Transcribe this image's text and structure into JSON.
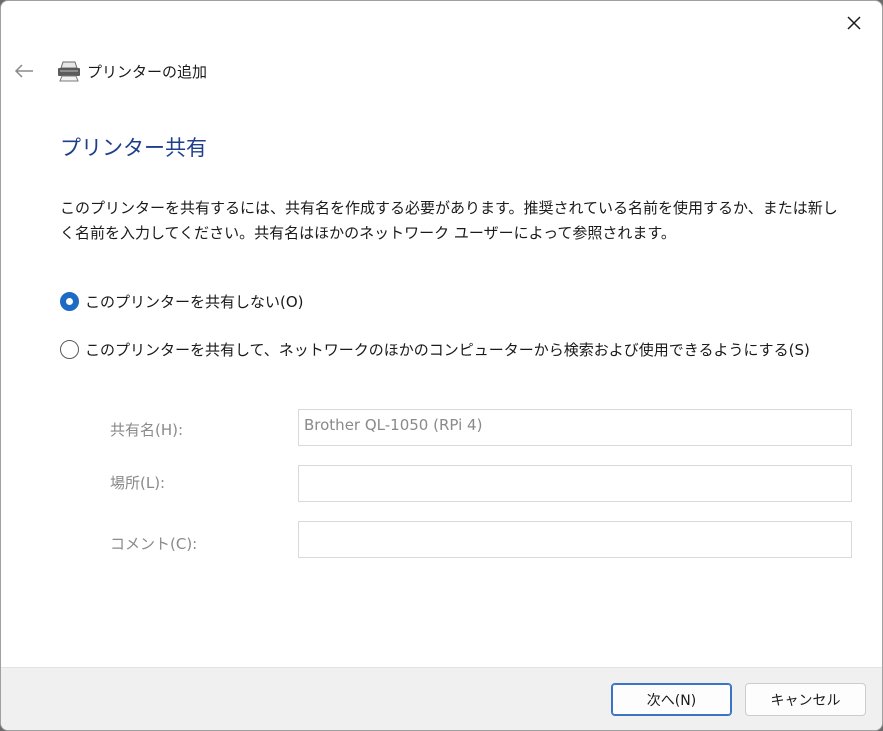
{
  "window": {
    "header_title": "プリンターの追加",
    "page_title": "プリンター共有",
    "description": "このプリンターを共有するには、共有名を作成する必要があります。推奨されている名前を使用するか、または新しく名前を入力してください。共有名はほかのネットワーク ユーザーによって参照されます。"
  },
  "sharing": {
    "options": [
      {
        "label": "このプリンターを共有しない(O)",
        "selected": true
      },
      {
        "label": "このプリンターを共有して、ネットワークのほかのコンピューターから検索および使用できるようにする(S)",
        "selected": false
      }
    ],
    "fields": {
      "share_name_label": "共有名(H):",
      "share_name_value": "Brother QL-1050 (RPi 4)",
      "location_label": "場所(L):",
      "location_value": "",
      "comment_label": "コメント(C):",
      "comment_value": ""
    }
  },
  "buttons": {
    "next": "次へ(N)",
    "cancel": "キャンセル"
  },
  "colors": {
    "accent": "#1d6bc5",
    "title": "#1f3f8c",
    "disabled_text": "#8a8a8a"
  }
}
